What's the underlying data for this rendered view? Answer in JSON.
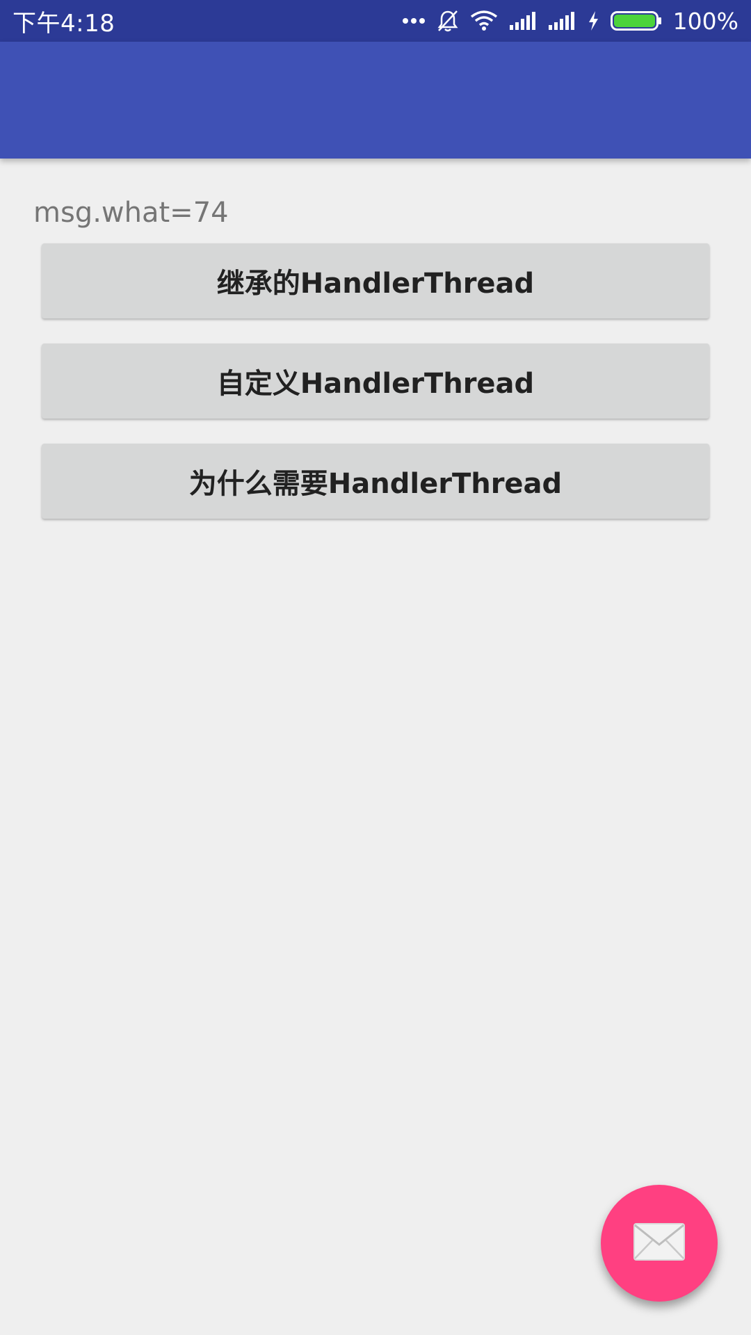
{
  "status_bar": {
    "time": "下午4:18",
    "battery_percent": "100%",
    "icons": [
      "more-dots-icon",
      "bell-off-icon",
      "wifi-icon",
      "signal-icon",
      "signal-icon",
      "charging-icon",
      "battery-icon"
    ],
    "battery_level": 1.0
  },
  "app_bar": {
    "color": "#3F51B5"
  },
  "content": {
    "message": "msg.what=74",
    "buttons": [
      {
        "label": "继承的HandlerThread"
      },
      {
        "label": "自定义HandlerThread"
      },
      {
        "label": "为什么需要HandlerThread"
      }
    ]
  },
  "fab": {
    "icon": "mail-icon",
    "color": "#FF4081"
  }
}
